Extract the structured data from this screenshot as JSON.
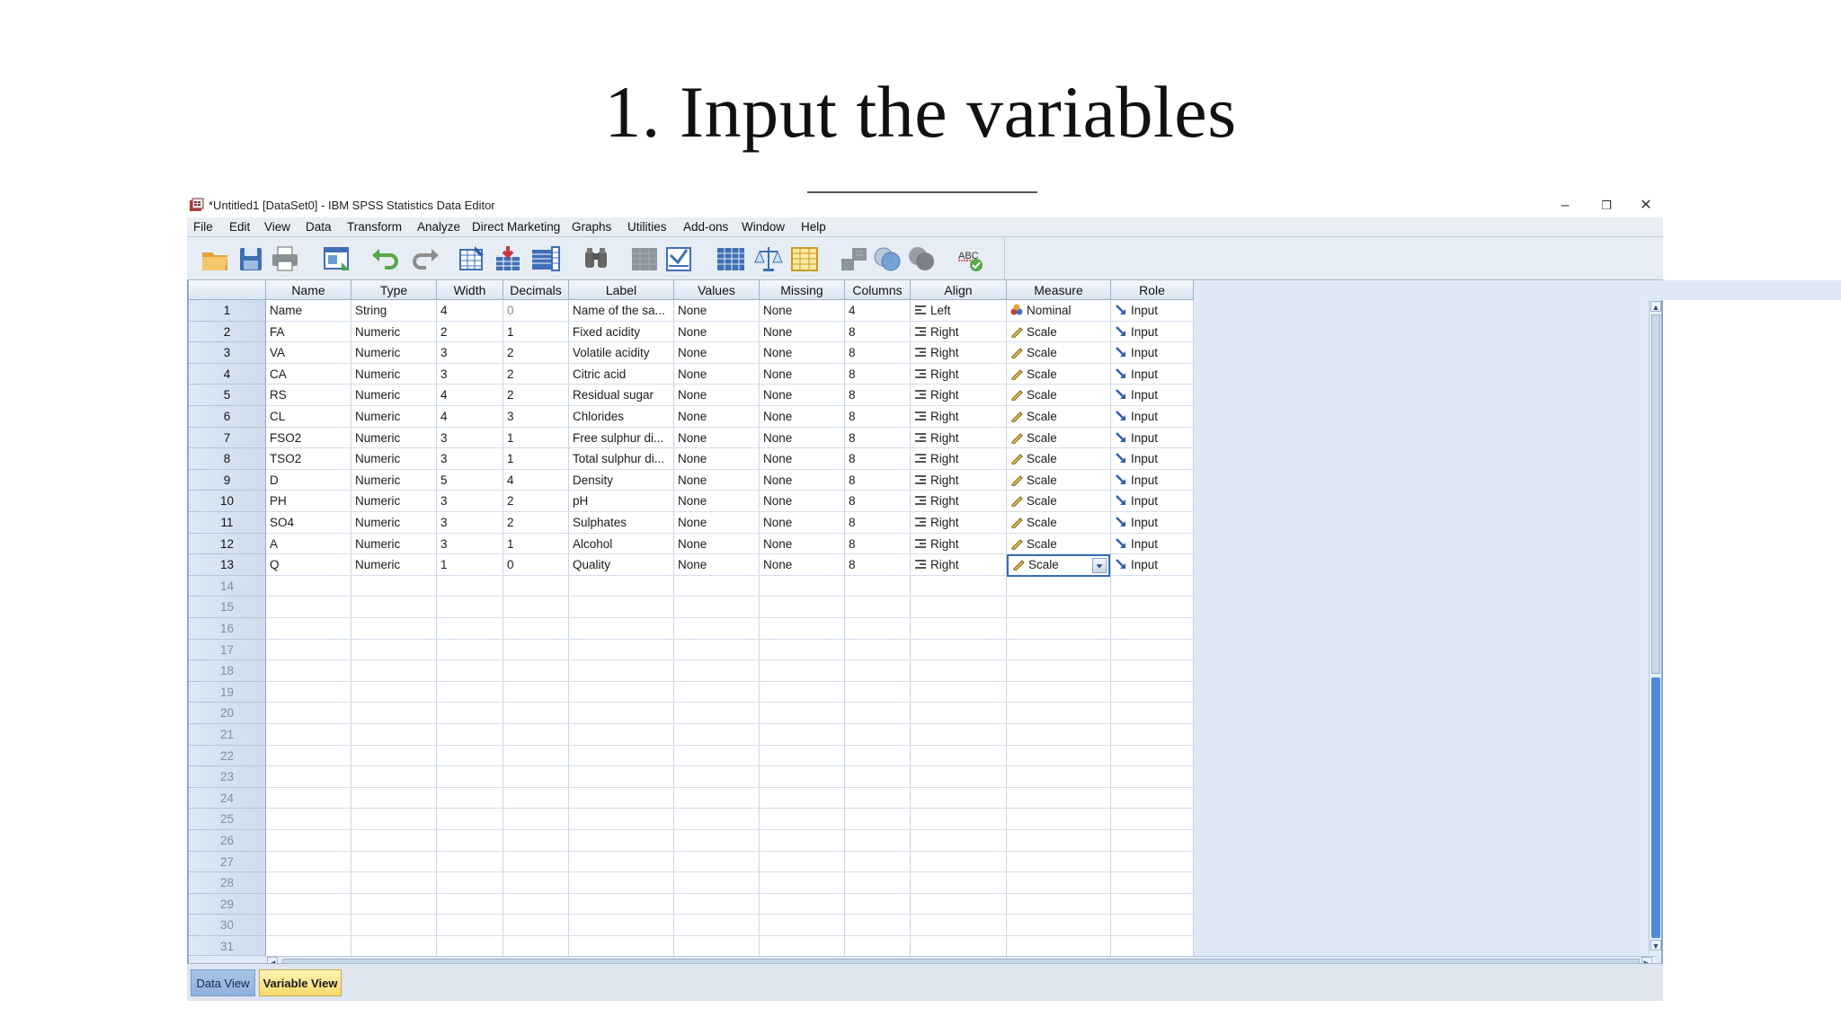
{
  "slide": {
    "title": "1. Input the variables"
  },
  "window": {
    "title": "*Untitled1 [DataSet0] - IBM SPSS Statistics Data Editor",
    "controls": {
      "minimize": "–",
      "restore": "❐",
      "close": "✕"
    }
  },
  "menu": [
    "File",
    "Edit",
    "View",
    "Data",
    "Transform",
    "Analyze",
    "Direct Marketing",
    "Graphs",
    "Utilities",
    "Add-ons",
    "Window",
    "Help"
  ],
  "toolbar": {
    "icons": [
      "open-data-icon",
      "save-icon",
      "print-icon",
      "recall-dialog-icon",
      "undo-icon",
      "redo-icon",
      "go-to-case-icon",
      "go-to-variable-icon",
      "variables-icon",
      "find-icon",
      "insert-cases-icon",
      "insert-variable-icon",
      "split-file-icon",
      "weight-cases-icon",
      "select-cases-icon",
      "value-labels-icon",
      "use-variable-sets-icon",
      "show-all-variables-icon",
      "spell-check-icon"
    ],
    "spell_label": "ABC"
  },
  "grid": {
    "columns": [
      "Name",
      "Type",
      "Width",
      "Decimals",
      "Label",
      "Values",
      "Missing",
      "Columns",
      "Align",
      "Measure",
      "Role"
    ],
    "rows": [
      {
        "num": "1",
        "name": "Name",
        "type": "String",
        "width": "4",
        "decimals": "0",
        "label": "Name of the sa...",
        "values": "None",
        "missing": "None",
        "columns": "4",
        "align": "Left",
        "measure": "Nominal",
        "role": "Input"
      },
      {
        "num": "2",
        "name": "FA",
        "type": "Numeric",
        "width": "2",
        "decimals": "1",
        "label": "Fixed acidity",
        "values": "None",
        "missing": "None",
        "columns": "8",
        "align": "Right",
        "measure": "Scale",
        "role": "Input"
      },
      {
        "num": "3",
        "name": "VA",
        "type": "Numeric",
        "width": "3",
        "decimals": "2",
        "label": "Volatile acidity",
        "values": "None",
        "missing": "None",
        "columns": "8",
        "align": "Right",
        "measure": "Scale",
        "role": "Input"
      },
      {
        "num": "4",
        "name": "CA",
        "type": "Numeric",
        "width": "3",
        "decimals": "2",
        "label": "Citric acid",
        "values": "None",
        "missing": "None",
        "columns": "8",
        "align": "Right",
        "measure": "Scale",
        "role": "Input"
      },
      {
        "num": "5",
        "name": "RS",
        "type": "Numeric",
        "width": "4",
        "decimals": "2",
        "label": "Residual sugar",
        "values": "None",
        "missing": "None",
        "columns": "8",
        "align": "Right",
        "measure": "Scale",
        "role": "Input"
      },
      {
        "num": "6",
        "name": "CL",
        "type": "Numeric",
        "width": "4",
        "decimals": "3",
        "label": "Chlorides",
        "values": "None",
        "missing": "None",
        "columns": "8",
        "align": "Right",
        "measure": "Scale",
        "role": "Input"
      },
      {
        "num": "7",
        "name": "FSO2",
        "type": "Numeric",
        "width": "3",
        "decimals": "1",
        "label": "Free sulphur di...",
        "values": "None",
        "missing": "None",
        "columns": "8",
        "align": "Right",
        "measure": "Scale",
        "role": "Input"
      },
      {
        "num": "8",
        "name": "TSO2",
        "type": "Numeric",
        "width": "3",
        "decimals": "1",
        "label": "Total sulphur di...",
        "values": "None",
        "missing": "None",
        "columns": "8",
        "align": "Right",
        "measure": "Scale",
        "role": "Input"
      },
      {
        "num": "9",
        "name": "D",
        "type": "Numeric",
        "width": "5",
        "decimals": "4",
        "label": "Density",
        "values": "None",
        "missing": "None",
        "columns": "8",
        "align": "Right",
        "measure": "Scale",
        "role": "Input"
      },
      {
        "num": "10",
        "name": "PH",
        "type": "Numeric",
        "width": "3",
        "decimals": "2",
        "label": "pH",
        "values": "None",
        "missing": "None",
        "columns": "8",
        "align": "Right",
        "measure": "Scale",
        "role": "Input"
      },
      {
        "num": "11",
        "name": "SO4",
        "type": "Numeric",
        "width": "3",
        "decimals": "2",
        "label": "Sulphates",
        "values": "None",
        "missing": "None",
        "columns": "8",
        "align": "Right",
        "measure": "Scale",
        "role": "Input"
      },
      {
        "num": "12",
        "name": "A",
        "type": "Numeric",
        "width": "3",
        "decimals": "1",
        "label": "Alcohol",
        "values": "None",
        "missing": "None",
        "columns": "8",
        "align": "Right",
        "measure": "Scale",
        "role": "Input"
      },
      {
        "num": "13",
        "name": "Q",
        "type": "Numeric",
        "width": "1",
        "decimals": "0",
        "label": "Quality",
        "values": "None",
        "missing": "None",
        "columns": "8",
        "align": "Right",
        "measure": "Scale",
        "role": "Input"
      }
    ],
    "empty_rows": [
      "14",
      "15",
      "16",
      "17",
      "18",
      "19",
      "20",
      "21",
      "22",
      "23",
      "24",
      "25",
      "26",
      "27",
      "28",
      "29",
      "30",
      "31"
    ]
  },
  "tabs": {
    "data_view": "Data View",
    "variable_view": "Variable View",
    "active": "variable_view"
  },
  "colors": {
    "grid_bg": "#dfe9f6",
    "selection_border": "#3b6db3",
    "variable_tab": "#f8d96b",
    "data_tab": "#8fb1dd"
  }
}
